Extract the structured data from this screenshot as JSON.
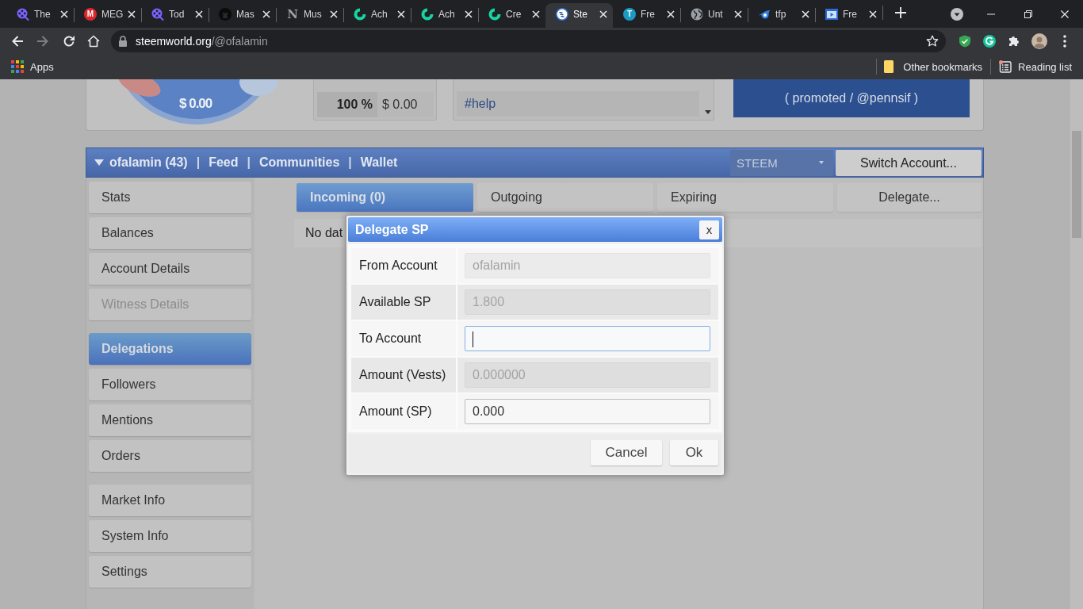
{
  "browser": {
    "tabs": [
      {
        "title": "The",
        "kind": "reel",
        "selected": false
      },
      {
        "title": "MEG",
        "kind": "letter-badge",
        "letter": "M",
        "color": "#d9272e",
        "selected": false
      },
      {
        "title": "Tod",
        "kind": "reel",
        "selected": false
      },
      {
        "title": "Mas",
        "kind": "round-logo",
        "selected": false
      },
      {
        "title": "Mus",
        "kind": "letter",
        "letter": "N",
        "color": "#9aa0a6",
        "selected": false
      },
      {
        "title": "Ach",
        "kind": "swirl",
        "selected": false
      },
      {
        "title": "Ach",
        "kind": "swirl",
        "selected": false
      },
      {
        "title": "Cre",
        "kind": "swirl",
        "selected": false
      },
      {
        "title": "Ste",
        "kind": "steem",
        "selected": true
      },
      {
        "title": "Fre",
        "kind": "letter-badge",
        "letter": "T",
        "color": "#1b9bc4",
        "selected": false
      },
      {
        "title": "Unt",
        "kind": "globe",
        "selected": false
      },
      {
        "title": "tfp",
        "kind": "comet",
        "selected": false
      },
      {
        "title": "Fre",
        "kind": "video",
        "selected": false
      }
    ],
    "back_disabled": false,
    "forward_disabled": true,
    "address": {
      "host": "steemworld.org",
      "path": "/@ofalamin"
    },
    "bookmarks": {
      "apps": "Apps",
      "other": "Other bookmarks",
      "reading_list": "Reading list"
    }
  },
  "header": {
    "vote_value": "$ 0.00",
    "vote_percent": "100 %",
    "vote_amount": "$ 0.00",
    "tag": "#help",
    "promo": "( promoted / @pennsif )"
  },
  "nav": {
    "items": [
      {
        "kind": "account",
        "label": "ofalamin (43)"
      },
      {
        "kind": "separator",
        "label": "|"
      },
      {
        "kind": "link",
        "label": "Feed"
      },
      {
        "kind": "separator",
        "label": "|"
      },
      {
        "kind": "link",
        "label": "Communities"
      },
      {
        "kind": "separator",
        "label": "|"
      },
      {
        "kind": "link",
        "label": "Wallet"
      }
    ],
    "currency": "STEEM",
    "switch_account": "Switch Account..."
  },
  "sidebar": {
    "groups": [
      {
        "items": [
          {
            "label": "Stats",
            "selected": false,
            "disabled": false
          },
          {
            "label": "Balances",
            "selected": false,
            "disabled": false
          },
          {
            "label": "Account Details",
            "selected": false,
            "disabled": false
          },
          {
            "label": "Witness Details",
            "selected": false,
            "disabled": true
          }
        ]
      },
      {
        "items": [
          {
            "label": "Delegations",
            "selected": true,
            "disabled": false
          },
          {
            "label": "Followers",
            "selected": false,
            "disabled": false
          },
          {
            "label": "Mentions",
            "selected": false,
            "disabled": false
          },
          {
            "label": "Orders",
            "selected": false,
            "disabled": false
          }
        ]
      },
      {
        "items": [
          {
            "label": "Market Info",
            "selected": false,
            "disabled": false
          },
          {
            "label": "System Info",
            "selected": false,
            "disabled": false
          },
          {
            "label": "Settings",
            "selected": false,
            "disabled": false
          }
        ]
      }
    ]
  },
  "delegations": {
    "tabs": [
      {
        "label": "Incoming (0)",
        "selected": true
      },
      {
        "label": "Outgoing",
        "selected": false
      },
      {
        "label": "Expiring",
        "selected": false
      }
    ],
    "delegate_button": "Delegate...",
    "message": "No dat"
  },
  "dialog": {
    "title": "Delegate SP",
    "close": "x",
    "fields": [
      {
        "label": "From Account",
        "value": "ofalamin",
        "disabled": true,
        "focused": false
      },
      {
        "label": "Available SP",
        "value": "1.800",
        "disabled": true,
        "focused": false
      },
      {
        "label": "To Account",
        "disabled": false,
        "focused": true
      },
      {
        "label": "Amount (Vests)",
        "value": "0.000000",
        "disabled": true,
        "focused": false
      },
      {
        "label": "Amount (SP)",
        "value": "0.000",
        "disabled": false,
        "focused": false
      }
    ],
    "buttons": [
      {
        "label": "Cancel"
      },
      {
        "label": "Ok"
      }
    ]
  }
}
